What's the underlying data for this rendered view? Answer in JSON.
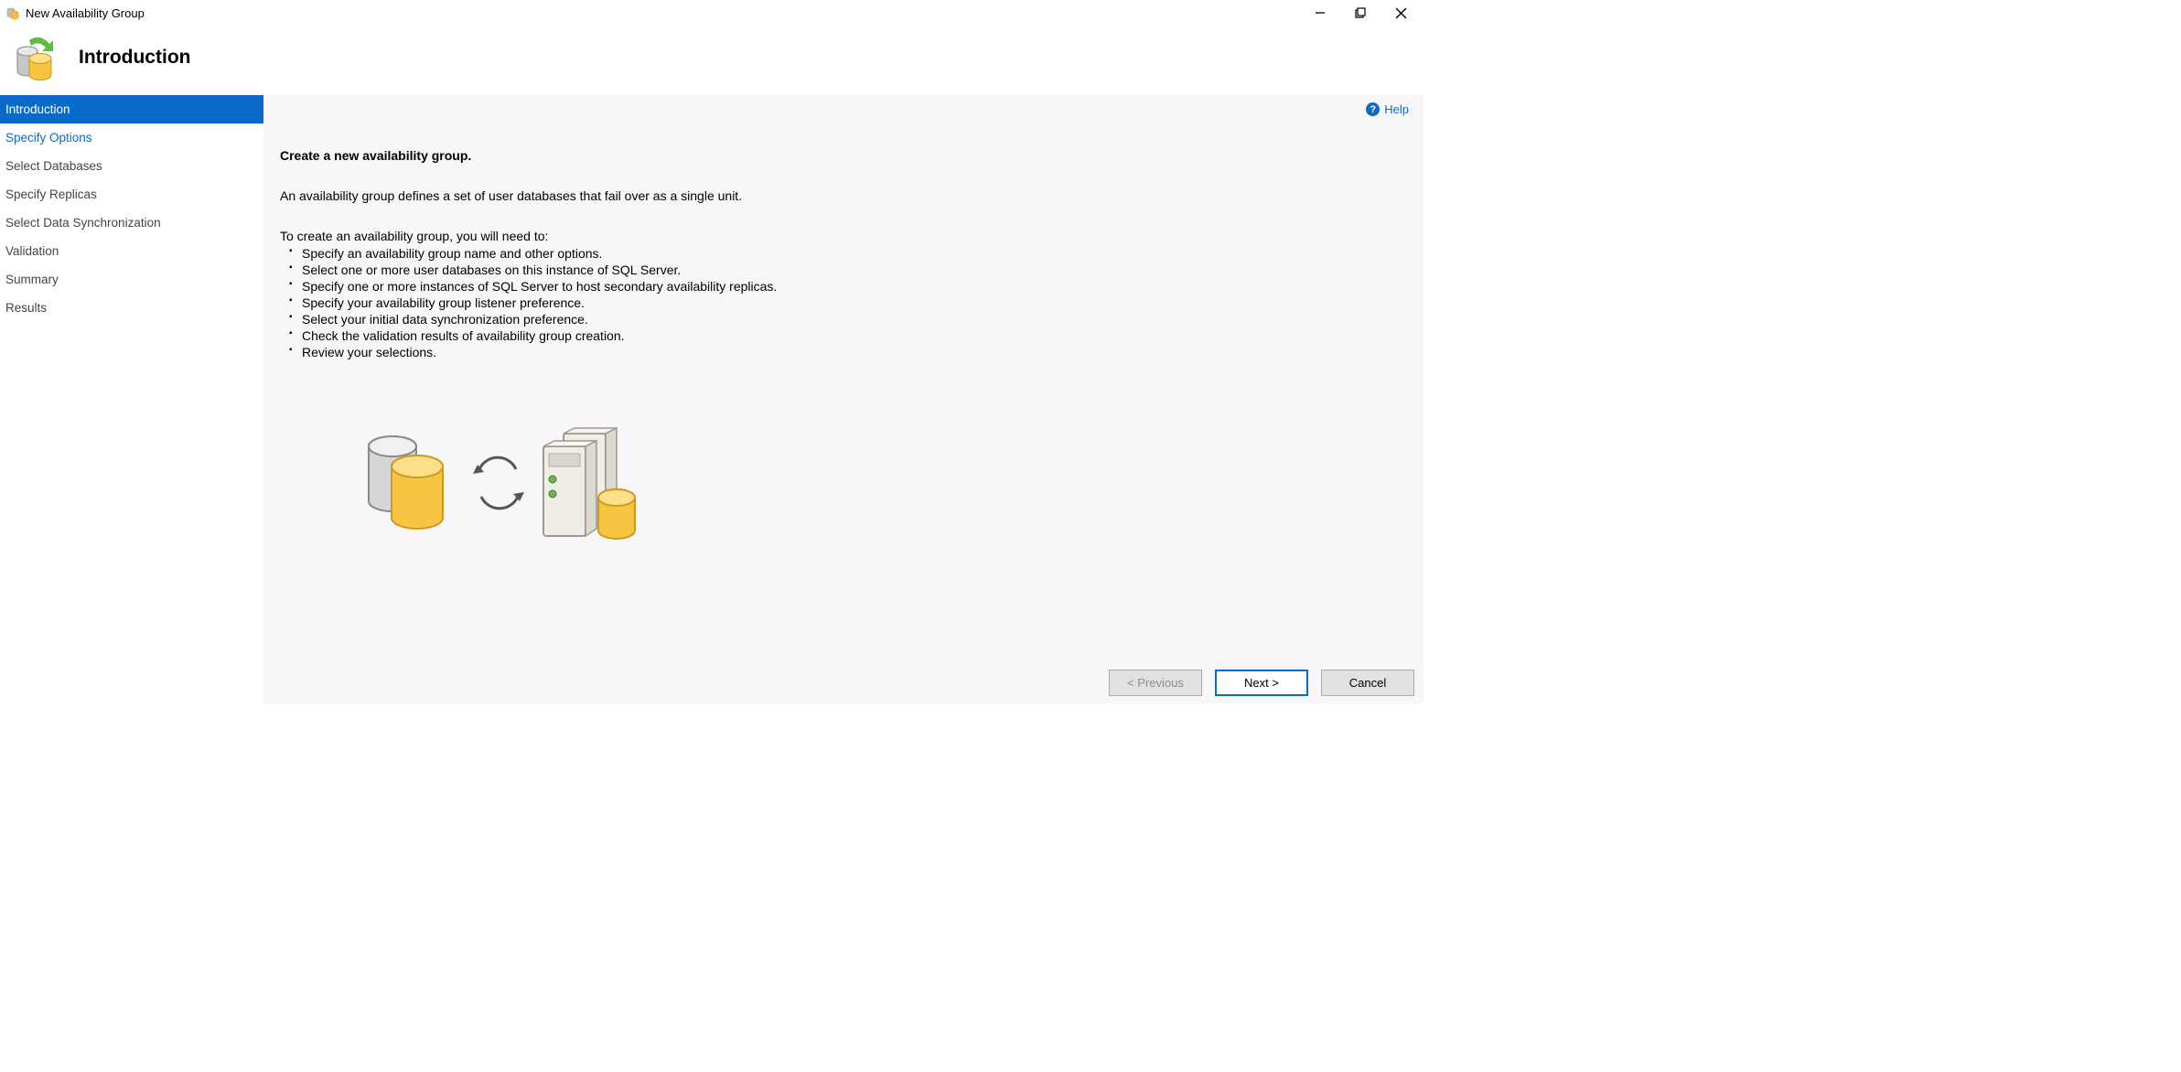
{
  "window": {
    "title": "New Availability Group"
  },
  "header": {
    "title": "Introduction"
  },
  "sidebar": {
    "items": [
      {
        "label": "Introduction"
      },
      {
        "label": "Specify Options"
      },
      {
        "label": "Select Databases"
      },
      {
        "label": "Specify Replicas"
      },
      {
        "label": "Select Data Synchronization"
      },
      {
        "label": "Validation"
      },
      {
        "label": "Summary"
      },
      {
        "label": "Results"
      }
    ]
  },
  "help": {
    "label": "Help"
  },
  "content": {
    "heading": "Create a new availability group.",
    "intro": "An availability group defines a set of user databases that fail over as a single unit.",
    "lead": "To create an availability group, you will need to:",
    "steps": [
      "Specify an availability group name and other options.",
      "Select one or more user databases on this instance of SQL Server.",
      "Specify one or more instances of SQL Server to host secondary availability replicas.",
      "Specify your availability group listener preference.",
      "Select your initial data synchronization preference.",
      "Check the validation results of availability group creation.",
      "Review your selections."
    ]
  },
  "buttons": {
    "previous": "< Previous",
    "next": "Next >",
    "cancel": "Cancel"
  }
}
